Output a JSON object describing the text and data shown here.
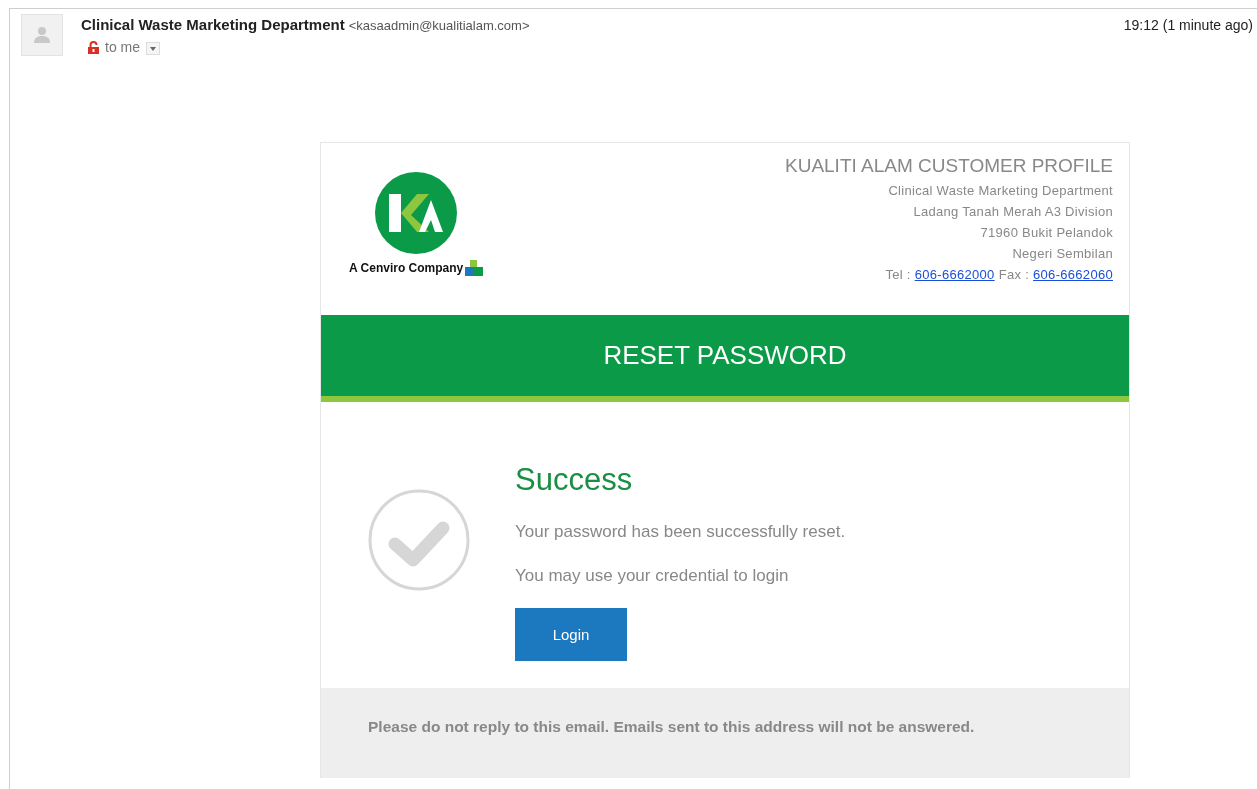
{
  "message": {
    "sender_name": "Clinical Waste Marketing Department",
    "sender_email": "<kasaadmin@kualitialam.com>",
    "time": "19:12 (1 minute ago)",
    "recipient": "to me",
    "encrypted": false
  },
  "email": {
    "logo_caption": "A Cenviro Company",
    "header_title": "KUALITI ALAM CUSTOMER PROFILE",
    "address_lines": [
      "Clinical Waste Marketing Department",
      "Ladang Tanah Merah A3 Division",
      "71960 Bukit Pelandok",
      "Negeri Sembilan"
    ],
    "tel_label": "Tel :",
    "tel": "606-6662000",
    "fax_label": "Fax :",
    "fax": "606-6662060",
    "banner": "RESET PASSWORD",
    "heading": "Success",
    "paragraphs": [
      "Your password has been successfully reset.",
      "You may use your credential to login"
    ],
    "button": "Login",
    "footer": "Please do not reply to this email. Emails sent to this address will not be answered."
  }
}
